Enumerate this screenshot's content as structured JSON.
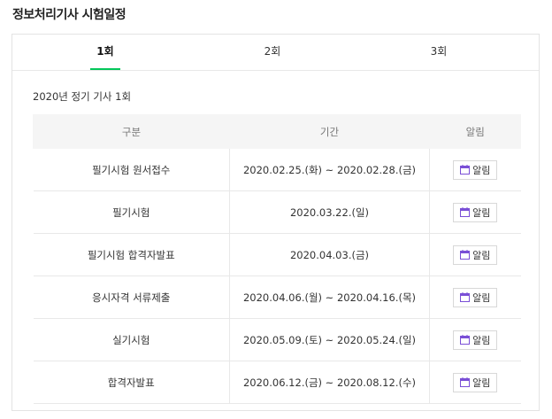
{
  "page_title": "정보처리기사 시험일정",
  "tabs": [
    {
      "label": "1회",
      "active": true
    },
    {
      "label": "2회",
      "active": false
    },
    {
      "label": "3회",
      "active": false
    }
  ],
  "schedule": {
    "subtitle": "2020년 정기 기사 1회",
    "columns": [
      "구분",
      "기간",
      "알림"
    ],
    "rows": [
      {
        "category": "필기시험 원서접수",
        "period": "2020.02.25.(화) ~ 2020.02.28.(금)",
        "alarm": "알림"
      },
      {
        "category": "필기시험",
        "period": "2020.03.22.(일)",
        "alarm": "알림"
      },
      {
        "category": "필기시험 합격자발표",
        "period": "2020.04.03.(금)",
        "alarm": "알림"
      },
      {
        "category": "응시자격 서류제출",
        "period": "2020.04.06.(월) ~ 2020.04.16.(목)",
        "alarm": "알림"
      },
      {
        "category": "실기시험",
        "period": "2020.05.09.(토) ~ 2020.05.24.(일)",
        "alarm": "알림"
      },
      {
        "category": "합격자발표",
        "period": "2020.06.12.(금) ~ 2020.08.12.(수)",
        "alarm": "알림"
      }
    ]
  },
  "colors": {
    "accent": "#03c75a",
    "icon": "#7a4fd6"
  },
  "icons": {
    "alarm": "calendar-icon"
  }
}
